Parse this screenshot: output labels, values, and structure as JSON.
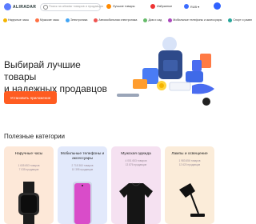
{
  "header": {
    "logo_text": "ALIRADAR",
    "search_placeholder": "Поиск на aliradar товаров и продавцов",
    "links": [
      {
        "label": "Лучшие товары",
        "icon": "trophy-icon"
      },
      {
        "label": "Избранное",
        "icon": "heart-icon"
      },
      {
        "label": "RUB ▾",
        "icon": "flag-icon"
      }
    ]
  },
  "categories_bar": [
    {
      "label": "Наручные часы",
      "color": "#f4b400"
    },
    {
      "label": "Мужские часы",
      "color": "#ff7043"
    },
    {
      "label": "Электроника",
      "color": "#42a5f5"
    },
    {
      "label": "Автомобильная электроника",
      "color": "#ef5350"
    },
    {
      "label": "Дом и сад",
      "color": "#66bb6a"
    },
    {
      "label": "Мобильные телефоны и аксессуары",
      "color": "#ab47bc"
    },
    {
      "label": "Спорт и развл",
      "color": "#26a69a"
    }
  ],
  "hero": {
    "title_line1": "Выбирай лучшие товары",
    "title_line2": "и надежных продавцов",
    "button_label": "Установить приложение"
  },
  "popular": {
    "title": "Полезные категории",
    "cards": [
      {
        "title": "Наручные часы",
        "sub1": "1 635 653 товаров",
        "sub2": "7 035 продавцов",
        "bg": "#fde8d8"
      },
      {
        "title": "Мобильные телефоны и аксессуары",
        "sub1": "2 715 360 товаров",
        "sub2": "10 395 продавцов",
        "bg": "#e2e9fb"
      },
      {
        "title": "Мужская одежда",
        "sub1": "4 001 653 товаров",
        "sub2": "13 876 продавцов",
        "bg": "#f5e1f1"
      },
      {
        "title": "Лампы и освещение",
        "sub1": "1 983 656 товаров",
        "sub2": "12 620 продавцов",
        "bg": "#fbecd9"
      }
    ]
  }
}
